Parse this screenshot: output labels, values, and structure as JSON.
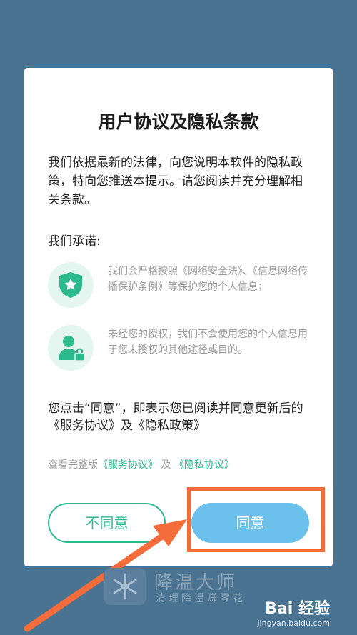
{
  "dialog": {
    "title": "用户协议及隐私条款",
    "intro": "我们依据最新的法律，向您说明本软件的隐私政策，特向您推送本提示。请您阅读并充分理解相关条款。",
    "promise_heading": "我们承诺:",
    "promises": [
      {
        "icon": "shield-star-icon",
        "text": "我们会严格按照《网络安全法》、《信息网络传播保护条例》等保护您的个人信息；"
      },
      {
        "icon": "user-lock-icon",
        "text": "未经您的授权，我们不会使用您的个人信息用于您未授权的其他途径或目的。"
      }
    ],
    "agree_note": "您点击“同意”，即表示您已阅读并同意更新后的《服务协议》及《隐私政策》",
    "links": {
      "prefix": "查看完整版",
      "service": "《服务协议》",
      "joiner": "及",
      "privacy": "《隐私协议》"
    },
    "buttons": {
      "disagree": "不同意",
      "agree": "同意"
    }
  },
  "brand": {
    "name": "降温大师",
    "slogan": "清理降温赚零花"
  },
  "watermark": {
    "name": "Bai 经验",
    "url": "jingyan.baidu.com"
  },
  "colors": {
    "background": "#4a7291",
    "accent_green": "#2cba8c",
    "agree_blue": "#6cc1ec",
    "highlight_orange": "#f36c3a"
  }
}
